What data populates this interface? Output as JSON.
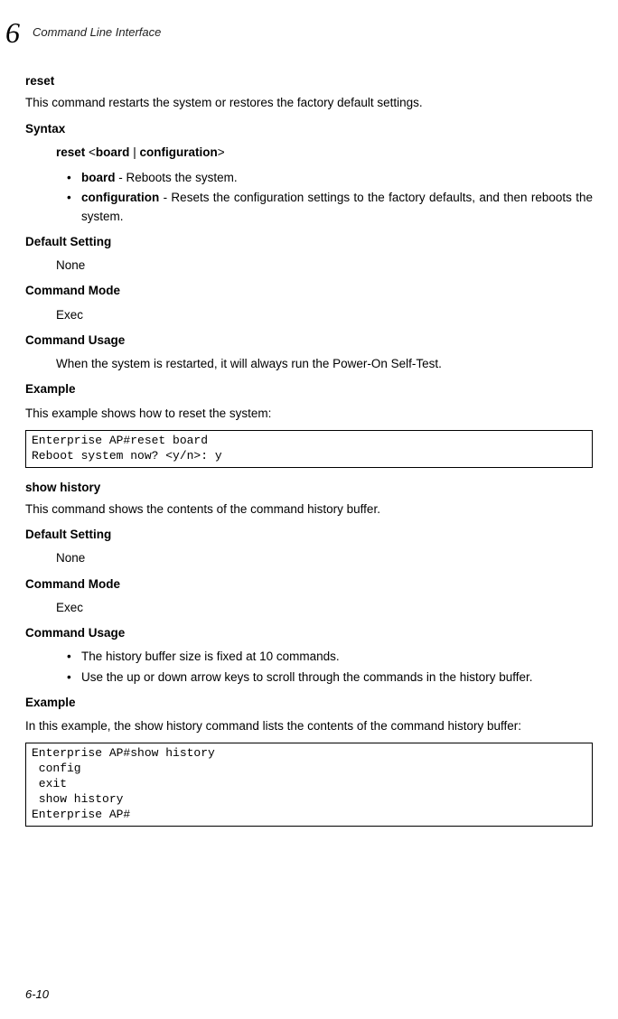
{
  "header": {
    "chapter_num": "6",
    "title": "Command Line Interface"
  },
  "reset": {
    "title": "reset",
    "desc": "This command restarts the system or restores the factory default settings.",
    "syntax_label": "Syntax",
    "syntax_pre": "reset",
    "syntax_open": " <",
    "syntax_opt1": "board",
    "syntax_sep": " | ",
    "syntax_opt2": "configuration",
    "syntax_close": ">",
    "bullets": {
      "b1_bold": "board",
      "b1_rest": " - Reboots the system.",
      "b2_bold": "configuration",
      "b2_rest": " - Resets the configuration settings to the factory defaults, and then reboots the system."
    },
    "default_label": "Default Setting",
    "default_val": "None",
    "mode_label": "Command Mode",
    "mode_val": "Exec",
    "usage_label": "Command Usage",
    "usage_text": "When the system is restarted, it will always run the Power-On Self-Test.",
    "example_label": "Example",
    "example_intro": "This example shows how to reset the system:",
    "code": "Enterprise AP#reset board\nReboot system now? <y/n>: y"
  },
  "showhist": {
    "title": "show history",
    "desc": "This command shows the contents of the command history buffer.",
    "default_label": "Default Setting",
    "default_val": "None",
    "mode_label": "Command Mode",
    "mode_val": "Exec",
    "usage_label": "Command Usage",
    "bullets": {
      "b1": "The history buffer size is fixed at 10 commands.",
      "b2": "Use the up or down arrow keys to scroll through the commands in the history buffer."
    },
    "example_label": "Example",
    "example_intro": "In this example, the show history command lists the contents of the command history buffer:",
    "code": "Enterprise AP#show history\n config\n exit\n show history\nEnterprise AP#"
  },
  "page_num": "6-10"
}
